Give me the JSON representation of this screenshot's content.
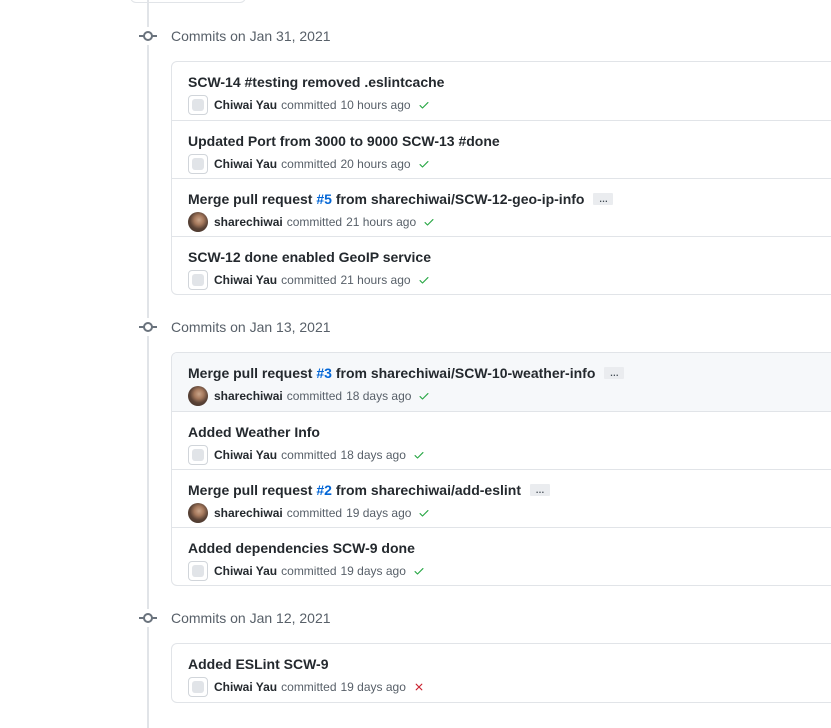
{
  "groups": [
    {
      "title": "Commits on Jan 31, 2021",
      "commits": [
        {
          "title": "SCW-14 #testing removed .eslintcache",
          "author": "Chiwai Yau",
          "avatar": "default",
          "verb": "committed",
          "time": "10 hours ago",
          "status": "success"
        },
        {
          "title": "Updated Port from 3000 to 9000 SCW-13 #done",
          "author": "Chiwai Yau",
          "avatar": "default",
          "verb": "committed",
          "time": "20 hours ago",
          "status": "success"
        },
        {
          "title_prefix": "Merge pull request ",
          "pr_link": "#5",
          "title_suffix": " from sharechiwai/SCW-12-geo-ip-info",
          "has_ellipsis": true,
          "ellipsis": "…",
          "author": "sharechiwai",
          "avatar": "photo",
          "verb": "committed",
          "time": "21 hours ago",
          "status": "success"
        },
        {
          "title": "SCW-12 done enabled GeoIP service",
          "author": "Chiwai Yau",
          "avatar": "default",
          "verb": "committed",
          "time": "21 hours ago",
          "status": "success"
        }
      ]
    },
    {
      "title": "Commits on Jan 13, 2021",
      "commits": [
        {
          "title_prefix": "Merge pull request ",
          "pr_link": "#3",
          "title_suffix": " from sharechiwai/SCW-10-weather-info",
          "has_ellipsis": true,
          "ellipsis": "…",
          "author": "sharechiwai",
          "avatar": "photo",
          "verb": "committed",
          "time": "18 days ago",
          "status": "success",
          "hovered": true
        },
        {
          "title": "Added Weather Info",
          "author": "Chiwai Yau",
          "avatar": "default",
          "verb": "committed",
          "time": "18 days ago",
          "status": "success"
        },
        {
          "title_prefix": "Merge pull request ",
          "pr_link": "#2",
          "title_suffix": " from sharechiwai/add-eslint",
          "has_ellipsis": true,
          "ellipsis": "…",
          "author": "sharechiwai",
          "avatar": "photo",
          "verb": "committed",
          "time": "19 days ago",
          "status": "success"
        },
        {
          "title": "Added dependencies SCW-9 done",
          "author": "Chiwai Yau",
          "avatar": "default",
          "verb": "committed",
          "time": "19 days ago",
          "status": "success"
        }
      ]
    },
    {
      "title": "Commits on Jan 12, 2021",
      "commits": [
        {
          "title": "Added ESLint SCW-9",
          "author": "Chiwai Yau",
          "avatar": "default",
          "verb": "committed",
          "time": "19 days ago",
          "status": "failure"
        }
      ]
    }
  ],
  "colors": {
    "success": "#28a745",
    "failure": "#cb2431",
    "link": "#0366d6",
    "muted": "#586069"
  },
  "icons": {
    "success": "check-icon",
    "failure": "x-icon",
    "group": "git-commit-icon"
  }
}
